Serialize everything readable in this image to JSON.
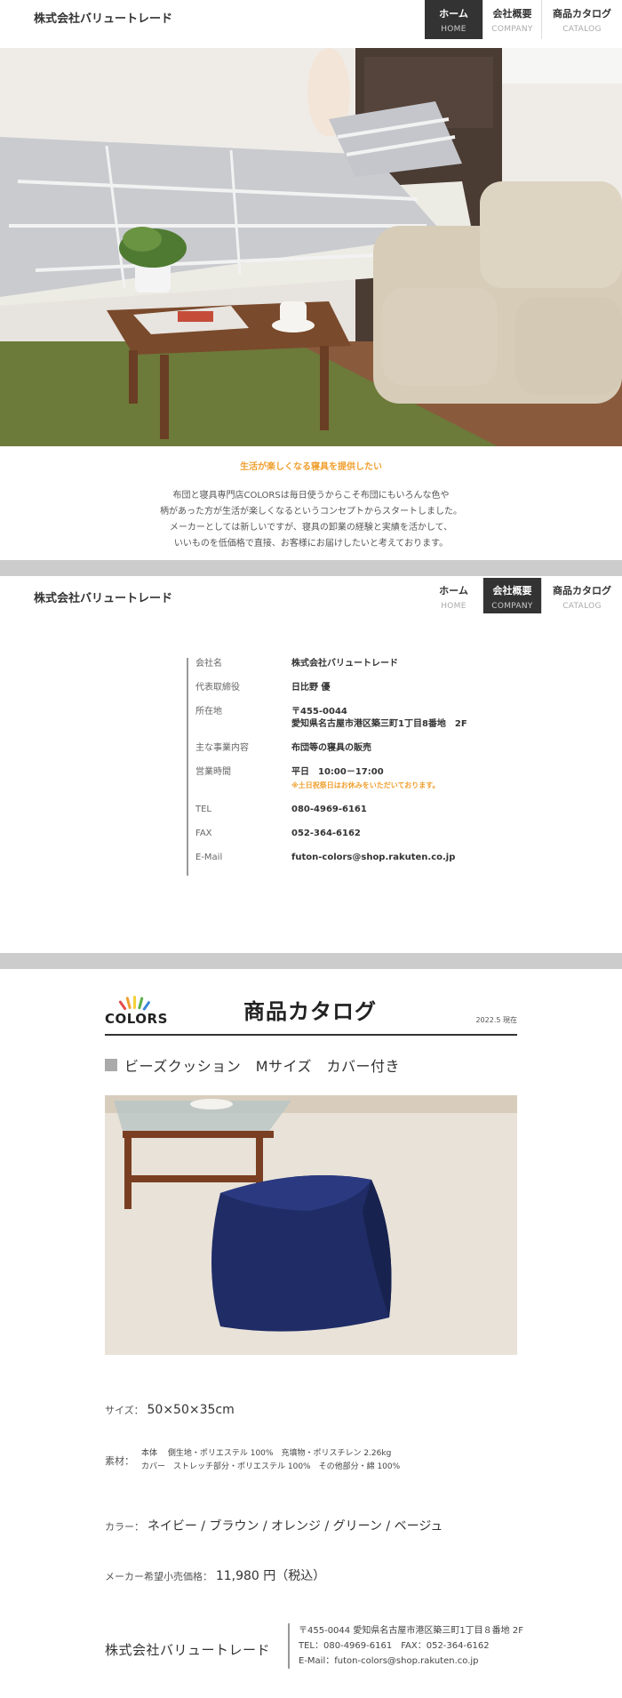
{
  "company_name": "株式会社バリュートレード",
  "nav": [
    {
      "ja": "ホーム",
      "en": "HOME"
    },
    {
      "ja": "会社概要",
      "en": "COMPANY"
    },
    {
      "ja": "商品カタログ",
      "en": "CATALOG"
    }
  ],
  "intro": {
    "title": "生活が楽しくなる寝具を提供したい",
    "lines": [
      "布団と寝具専門店COLORSは毎日使うからこそ布団にもいろんな色や",
      "柄があった方が生活が楽しくなるというコンセプトからスタートしました。",
      "メーカーとしては新しいですが、寝具の卸業の経験と実績を活かして、",
      "いいものを低価格で直接、お客様にお届けしたいと考えております。"
    ]
  },
  "company_info": {
    "rows": [
      {
        "label": "会社名",
        "value": "株式会社バリュートレード"
      },
      {
        "label": "代表取締役",
        "value": "日比野 優"
      },
      {
        "label": "所在地",
        "value": "〒455-0044",
        "value2": "愛知県名古屋市港区築三町1丁目8番地　2F"
      },
      {
        "label": "主な事業内容",
        "value": "布団等の寝具の販売"
      },
      {
        "label": "営業時間",
        "value": "平日　10:00－17:00",
        "note": "※土日祝祭日はお休みをいただいております。"
      },
      {
        "label": "TEL",
        "value": "080-4969-6161"
      },
      {
        "label": "FAX",
        "value": "052-364-6162"
      },
      {
        "label": "E-Mail",
        "value": "futon-colors@shop.rakuten.co.jp"
      }
    ]
  },
  "catalog": {
    "brand": "COLORS",
    "title": "商品カタログ",
    "date": "2022.5 現在",
    "product_name": "ビーズクッション　Mサイズ　カバー付き",
    "size_key": "サイズ：",
    "size_val": "50×50×35cm",
    "material_key": "素材：",
    "material_lines": [
      "本体　 側生地・ポリエステル 100%　充填物・ポリスチレン 2.26kg",
      "カバー　ストレッチ部分・ポリエステル 100%　その他部分・綿 100%"
    ],
    "color_key": "カラー：",
    "color_val": "ネイビー / ブラウン / オレンジ / グリーン / ベージュ",
    "price_key": "メーカー希望小売価格：",
    "price_val": "11,980 円（税込）"
  },
  "footer": {
    "name": "株式会社バリュートレード",
    "address": "〒455-0044 愛知県名古屋市港区築三町1丁目８番地 2F",
    "telfax": "TEL：080-4969-6161　FAX：052-364-6162",
    "email": "E-Mail：futon-colors@shop.rakuten.co.jp"
  },
  "colors": {
    "accent": "#f0a030",
    "divider": "#cccccc",
    "nav_active": "#333333"
  }
}
